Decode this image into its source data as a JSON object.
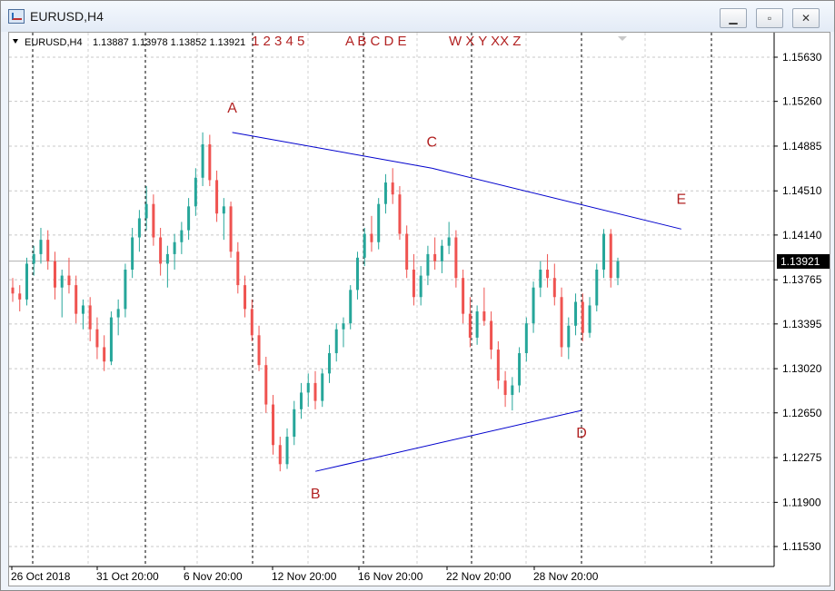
{
  "window": {
    "title": "EURUSD,H4",
    "minimize_label": "▁",
    "maximize_label": "▫",
    "close_label": "✕"
  },
  "info": {
    "symbol": "EURUSD,H4",
    "ohlc": "1.13887 1.13978 1.13852 1.13921"
  },
  "markers": {
    "group1": "1 2 3 4 5",
    "group2": "A B C D E",
    "group3": "W X Y XX Z"
  },
  "points": [
    {
      "label": "A",
      "date": "2018-11-07",
      "price": 1.15
    },
    {
      "label": "B",
      "date": "2018-11-12",
      "price": 1.1216
    },
    {
      "label": "C",
      "date": "2018-11-19",
      "price": 1.147
    },
    {
      "label": "D",
      "date": "2018-11-28",
      "price": 1.1267
    },
    {
      "label": "E",
      "date": "2018-12-04",
      "price": 1.1419
    }
  ],
  "price_axis": [
    "1.15630",
    "1.15260",
    "1.14885",
    "1.14510",
    "1.14140",
    "1.13765",
    "1.13395",
    "1.13020",
    "1.12650",
    "1.12275",
    "1.11900",
    "1.11530"
  ],
  "current_price": "1.13921",
  "time_axis": [
    "26 Oct 2018",
    "31 Oct 20:00",
    "6 Nov 20:00",
    "12 Nov 20:00",
    "16 Nov 20:00",
    "22 Nov 20:00",
    "28 Nov 20:00"
  ],
  "colors": {
    "bull": "#26a69a",
    "bear": "#ef5350",
    "trendline": "#0000cd",
    "label": "#b22222"
  },
  "chart_data": {
    "type": "candlestick",
    "symbol": "EURUSD,H4",
    "ylim": [
      1.115,
      1.1585
    ],
    "candles": [
      [
        1.137,
        1.1378,
        1.1358,
        1.1365
      ],
      [
        1.1365,
        1.1372,
        1.135,
        1.136
      ],
      [
        1.136,
        1.1395,
        1.1355,
        1.139
      ],
      [
        1.139,
        1.1405,
        1.138,
        1.1398
      ],
      [
        1.1398,
        1.142,
        1.139,
        1.141
      ],
      [
        1.141,
        1.1418,
        1.1385,
        1.1392
      ],
      [
        1.1392,
        1.14,
        1.136,
        1.137
      ],
      [
        1.137,
        1.1385,
        1.1345,
        1.138
      ],
      [
        1.138,
        1.1395,
        1.1365,
        1.1372
      ],
      [
        1.1372,
        1.138,
        1.134,
        1.1348
      ],
      [
        1.1348,
        1.136,
        1.1335,
        1.1355
      ],
      [
        1.1355,
        1.1362,
        1.1325,
        1.1335
      ],
      [
        1.1335,
        1.1345,
        1.131,
        1.132
      ],
      [
        1.132,
        1.133,
        1.13,
        1.1308
      ],
      [
        1.1308,
        1.135,
        1.1305,
        1.1345
      ],
      [
        1.1345,
        1.136,
        1.133,
        1.1352
      ],
      [
        1.1352,
        1.139,
        1.1345,
        1.1385
      ],
      [
        1.1385,
        1.142,
        1.1378,
        1.1412
      ],
      [
        1.1412,
        1.1435,
        1.14,
        1.1428
      ],
      [
        1.1428,
        1.1455,
        1.1418,
        1.144
      ],
      [
        1.144,
        1.1448,
        1.1405,
        1.1412
      ],
      [
        1.1412,
        1.142,
        1.138,
        1.139
      ],
      [
        1.139,
        1.1405,
        1.137,
        1.1398
      ],
      [
        1.1398,
        1.1415,
        1.1385,
        1.1408
      ],
      [
        1.1408,
        1.1425,
        1.1398,
        1.1418
      ],
      [
        1.1418,
        1.1445,
        1.141,
        1.1438
      ],
      [
        1.1438,
        1.147,
        1.143,
        1.1462
      ],
      [
        1.1462,
        1.15,
        1.1455,
        1.149
      ],
      [
        1.149,
        1.1498,
        1.1455,
        1.146
      ],
      [
        1.146,
        1.1468,
        1.1425,
        1.1432
      ],
      [
        1.1432,
        1.1445,
        1.141,
        1.1438
      ],
      [
        1.1438,
        1.1442,
        1.1395,
        1.14
      ],
      [
        1.14,
        1.1408,
        1.1365,
        1.1372
      ],
      [
        1.1372,
        1.138,
        1.1345,
        1.1352
      ],
      [
        1.1352,
        1.136,
        1.1325,
        1.133
      ],
      [
        1.133,
        1.1338,
        1.13,
        1.1305
      ],
      [
        1.1305,
        1.1312,
        1.1265,
        1.1272
      ],
      [
        1.1272,
        1.128,
        1.123,
        1.1238
      ],
      [
        1.1238,
        1.1245,
        1.1216,
        1.1222
      ],
      [
        1.1222,
        1.1252,
        1.1218,
        1.1245
      ],
      [
        1.1245,
        1.1275,
        1.1238,
        1.1268
      ],
      [
        1.1268,
        1.129,
        1.126,
        1.1282
      ],
      [
        1.1282,
        1.1298,
        1.127,
        1.129
      ],
      [
        1.129,
        1.13,
        1.1268,
        1.1275
      ],
      [
        1.1275,
        1.1302,
        1.127,
        1.1298
      ],
      [
        1.1298,
        1.1322,
        1.129,
        1.1315
      ],
      [
        1.1315,
        1.134,
        1.1308,
        1.1335
      ],
      [
        1.1335,
        1.1345,
        1.132,
        1.134
      ],
      [
        1.134,
        1.1372,
        1.1335,
        1.1368
      ],
      [
        1.1368,
        1.14,
        1.136,
        1.1395
      ],
      [
        1.1395,
        1.142,
        1.1388,
        1.1415
      ],
      [
        1.1415,
        1.143,
        1.14,
        1.1408
      ],
      [
        1.1408,
        1.1445,
        1.1402,
        1.144
      ],
      [
        1.144,
        1.1465,
        1.1432,
        1.1458
      ],
      [
        1.1458,
        1.147,
        1.144,
        1.1448
      ],
      [
        1.1448,
        1.1455,
        1.141,
        1.1415
      ],
      [
        1.1415,
        1.1422,
        1.1378,
        1.1385
      ],
      [
        1.1385,
        1.1398,
        1.1355,
        1.1362
      ],
      [
        1.1362,
        1.1388,
        1.1355,
        1.138
      ],
      [
        1.138,
        1.1405,
        1.1372,
        1.1398
      ],
      [
        1.1398,
        1.1412,
        1.1385,
        1.1392
      ],
      [
        1.1392,
        1.141,
        1.1382,
        1.1405
      ],
      [
        1.1405,
        1.1425,
        1.1398,
        1.1412
      ],
      [
        1.1412,
        1.1418,
        1.137,
        1.1378
      ],
      [
        1.1378,
        1.1385,
        1.134,
        1.1348
      ],
      [
        1.1348,
        1.1362,
        1.132,
        1.1328
      ],
      [
        1.1328,
        1.1355,
        1.1322,
        1.135
      ],
      [
        1.135,
        1.137,
        1.1338,
        1.1342
      ],
      [
        1.1342,
        1.135,
        1.131,
        1.1318
      ],
      [
        1.1318,
        1.1325,
        1.1285,
        1.1292
      ],
      [
        1.1292,
        1.13,
        1.127,
        1.128
      ],
      [
        1.128,
        1.1295,
        1.1267,
        1.1288
      ],
      [
        1.1288,
        1.132,
        1.1282,
        1.1315
      ],
      [
        1.1315,
        1.1345,
        1.1308,
        1.134
      ],
      [
        1.134,
        1.1375,
        1.1332,
        1.137
      ],
      [
        1.137,
        1.1392,
        1.1362,
        1.1385
      ],
      [
        1.1385,
        1.1398,
        1.137,
        1.1378
      ],
      [
        1.1378,
        1.139,
        1.1355,
        1.1362
      ],
      [
        1.1362,
        1.137,
        1.1312,
        1.132
      ],
      [
        1.132,
        1.1345,
        1.131,
        1.1338
      ],
      [
        1.1338,
        1.1365,
        1.133,
        1.1358
      ],
      [
        1.1358,
        1.1365,
        1.1325,
        1.1332
      ],
      [
        1.1332,
        1.1362,
        1.1328,
        1.1355
      ],
      [
        1.1355,
        1.139,
        1.135,
        1.1385
      ],
      [
        1.1385,
        1.1419,
        1.1378,
        1.1415
      ],
      [
        1.1415,
        1.1419,
        1.137,
        1.1378
      ],
      [
        1.1378,
        1.1395,
        1.1372,
        1.1392
      ]
    ]
  }
}
